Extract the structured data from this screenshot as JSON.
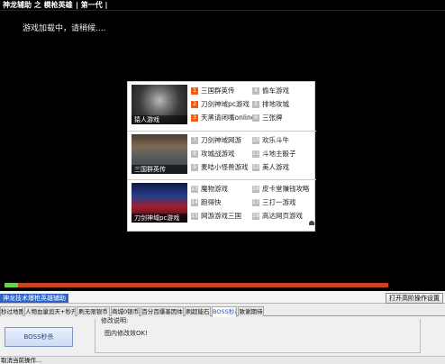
{
  "window": {
    "title": "神龙辅助 之 模枪英雄",
    "subtitle": "| 第一代 |"
  },
  "game": {
    "loading_text": "游戏加载中，请稍候....",
    "progress_fraction": 0.035
  },
  "ad_panel": {
    "sections": [
      {
        "thumb_caption": "猿人游戏",
        "items": [
          {
            "num": "1",
            "label": "三国群英传",
            "hot": true
          },
          {
            "num": "2",
            "label": "刀剑神域pc游戏",
            "hot": true
          },
          {
            "num": "3",
            "label": "天黑请闭嘴online",
            "hot": true
          },
          {
            "num": "4",
            "label": "偷车游戏",
            "hot": false
          },
          {
            "num": "5",
            "label": "排地攻城",
            "hot": false
          },
          {
            "num": "6",
            "label": "三张牌",
            "hot": false
          }
        ]
      },
      {
        "thumb_caption": "三国群英传",
        "items": [
          {
            "num": "7",
            "label": "刀剑神域网游",
            "hot": false
          },
          {
            "num": "8",
            "label": "攻城战游戏",
            "hot": false
          },
          {
            "num": "9",
            "label": "麦咭小怪兽游戏",
            "hot": false
          },
          {
            "num": "10",
            "label": "欢乐斗牛",
            "hot": false
          },
          {
            "num": "11",
            "label": "斗地主骰子",
            "hot": false
          },
          {
            "num": "12",
            "label": "美人游戏",
            "hot": false
          }
        ]
      },
      {
        "thumb_caption": "刀剑神域pc游戏",
        "items": [
          {
            "num": "13",
            "label": "魔物游戏",
            "hot": false
          },
          {
            "num": "14",
            "label": "跑得快",
            "hot": false
          },
          {
            "num": "15",
            "label": "网游游戏三国",
            "hot": false
          },
          {
            "num": "16",
            "label": "皮卡堂赚钱攻略",
            "hot": false
          },
          {
            "num": "17",
            "label": "三打一游戏",
            "hot": false
          },
          {
            "num": "18",
            "label": "高达网页游戏",
            "hot": false
          }
        ]
      }
    ]
  },
  "control": {
    "title": "神龙技术爆枪英雄辅助",
    "advanced_button": "打开高阶操作设置",
    "tabs": [
      {
        "label": "秒过地图",
        "active": false
      },
      {
        "label": "人物血量追天+秒开",
        "active": false
      },
      {
        "label": "刷无限银币",
        "active": false
      },
      {
        "label": "商城0银币",
        "active": false
      },
      {
        "label": "百分百爆基因体",
        "active": false
      },
      {
        "label": "刷超能石",
        "active": false
      },
      {
        "label": "BOSS秒杀",
        "active": true
      },
      {
        "label": "致谢期待",
        "active": false
      }
    ],
    "action_button": "BOSS秒杀",
    "desc_legend": "修改说明:",
    "desc_text": "图内修改效OK!"
  },
  "status": {
    "text": "取消当前操作..."
  }
}
